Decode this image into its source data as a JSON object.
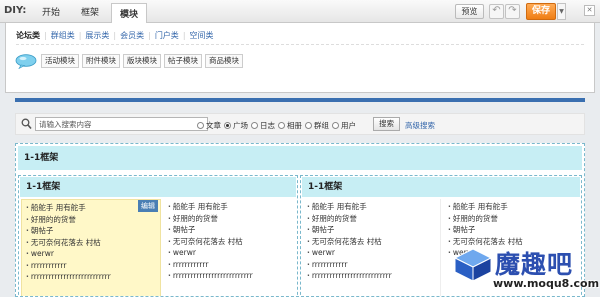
{
  "diy": {
    "label": "DIY:",
    "tabs": [
      "开始",
      "框架",
      "模块"
    ],
    "active_tab": 2,
    "preview_label": "预览",
    "save_label": "保存"
  },
  "categories": [
    "论坛类",
    "群组类",
    "展示类",
    "会员类",
    "门户类",
    "空间类"
  ],
  "modules": [
    "活动模块",
    "附件模块",
    "版块模块",
    "帖子模块",
    "商品模块"
  ],
  "search": {
    "placeholder": "请输入搜索内容",
    "options": [
      "文章",
      "广场",
      "日志",
      "相册",
      "群组",
      "用户"
    ],
    "selected": "广场",
    "button_label": "搜索",
    "advanced_label": "高级搜索"
  },
  "outer_frame": {
    "title": "1-1框架"
  },
  "left_frame": {
    "title": "1-1框架",
    "edit_label": "编辑",
    "col1": [
      "船舵手 用有舵手",
      "好朋的的货誉",
      "朝帖子",
      "无可奈何花落去 村枯",
      "werwr",
      "rrrrrrrrrrrr",
      "rrrrrrrrrrrrrrrrrrrrrrrrrrr"
    ],
    "col2": [
      "船舵手 用有舵手",
      "好朋的的货誉",
      "朝帖子",
      "无可奈何花落去 村枯",
      "werwr",
      "rrrrrrrrrrrr",
      "rrrrrrrrrrrrrrrrrrrrrrrrrrr"
    ]
  },
  "right_frame": {
    "title": "1-1框架",
    "col1": [
      "船舵手 用有舵手",
      "好朋的的货誉",
      "朝帖子",
      "无可奈何花落去 村枯",
      "werwr",
      "rrrrrrrrrrrr",
      "rrrrrrrrrrrrrrrrrrrrrrrrrrr"
    ],
    "col2": [
      "船舵手 用有舵手",
      "好朋的的货誉",
      "朝帖子",
      "无可奈何花落去 村枯",
      "werwr"
    ]
  },
  "watermark": {
    "title": "魔趣吧",
    "url": "www.moqu8.com"
  },
  "colors": {
    "accent": "#ef7d14",
    "frame_head": "#c7eef4",
    "link": "#3366aa",
    "highlight": "#fff8c8"
  }
}
